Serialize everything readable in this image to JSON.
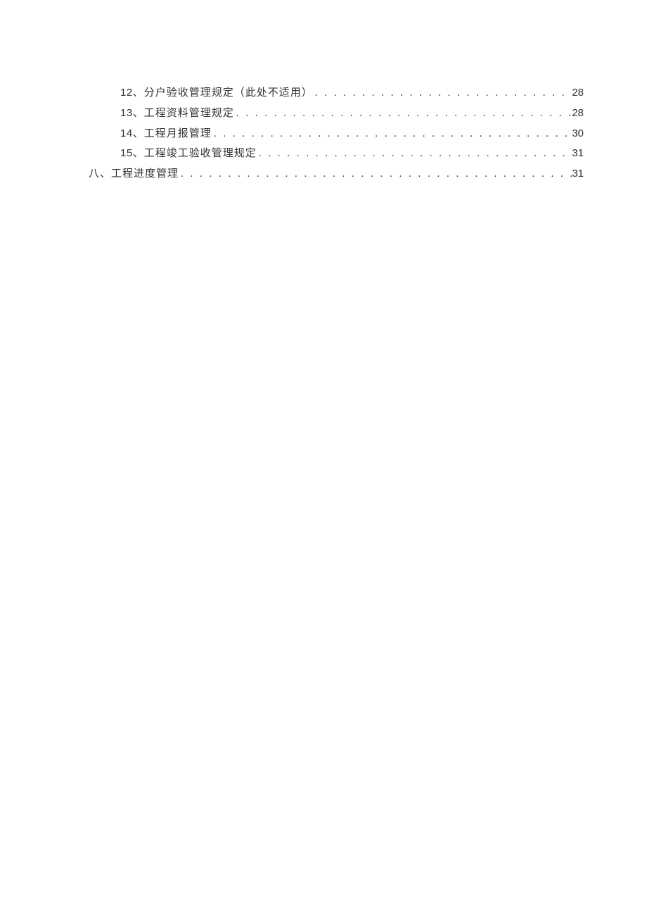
{
  "toc": {
    "entries": [
      {
        "level": "indent",
        "num": "12",
        "sep": "、",
        "title": "分户验收管理规定（此处不适用）",
        "page": "28"
      },
      {
        "level": "indent",
        "num": "13",
        "sep": "、",
        "title": "工程资料管理规定",
        "page": "28"
      },
      {
        "level": "indent",
        "num": "14",
        "sep": "、",
        "title": "工程月报管理",
        "page": "30"
      },
      {
        "level": "indent",
        "num": "15",
        "sep": "、",
        "title": "工程竣工验收管理规定",
        "page": "31"
      },
      {
        "level": "top",
        "num": "八",
        "sep": "、",
        "title": "工程进度管理",
        "page": "31"
      }
    ]
  }
}
